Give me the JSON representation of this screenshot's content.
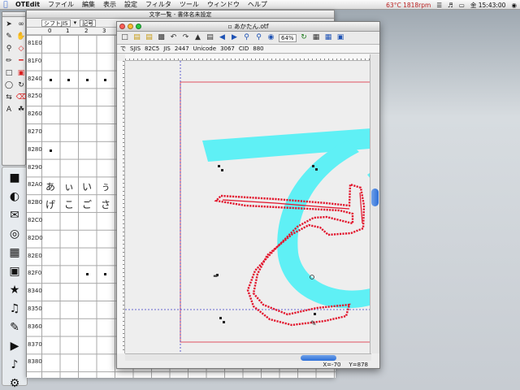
{
  "menubar": {
    "app_name": "OTEdit",
    "menus": [
      "ファイル",
      "編集",
      "表示",
      "設定",
      "フィルタ",
      "ツール",
      "ウィンドウ",
      "ヘルプ"
    ],
    "cpu_status": "63°C 1818rpm",
    "clock": "金 15:43:00"
  },
  "palette": {
    "tools": [
      "arrow",
      "lasso",
      "pen",
      "hand",
      "zoom",
      "node-red",
      "pencil",
      "knife",
      "rect",
      "rect-red",
      "oval",
      "rotate",
      "flip",
      "eraser",
      "text",
      "brush"
    ]
  },
  "table_window": {
    "title": "文字一覧 - 書体名未設定",
    "encoding_select": "シフトJIS",
    "category_select": "記号",
    "column_headers": [
      "0",
      "1",
      "2",
      "3"
    ],
    "row_labels": [
      "81E0",
      "81F0",
      "8240",
      "8250",
      "8260",
      "8270",
      "8280",
      "8290",
      "82A0",
      "82B0",
      "82C0",
      "82D0",
      "82E0",
      "82F0",
      "8340",
      "8350",
      "8360",
      "8370",
      "8380"
    ],
    "glyph_row_1": [
      "あ",
      "ぃ",
      "い",
      "ぅ"
    ],
    "glyph_row_2": [
      "げ",
      "こ",
      "ご",
      "さ"
    ]
  },
  "editor_window": {
    "title": "あかたん.otf",
    "zoom_value": "64%",
    "char": "で",
    "sjis_label": "SJIS",
    "sjis_value": "82C5",
    "jis_label": "JIS",
    "jis_value": "2447",
    "unicode_label": "Unicode",
    "unicode_value": "3067",
    "cid_label": "CID",
    "cid_value": "880",
    "coord_x": "X=-70",
    "coord_y": "Y=878",
    "colors": {
      "reference_glyph": "#5ff0f5",
      "outline_points": "#e2162d",
      "em_box": "#e05060",
      "baseline": "#3b3bc8"
    }
  }
}
